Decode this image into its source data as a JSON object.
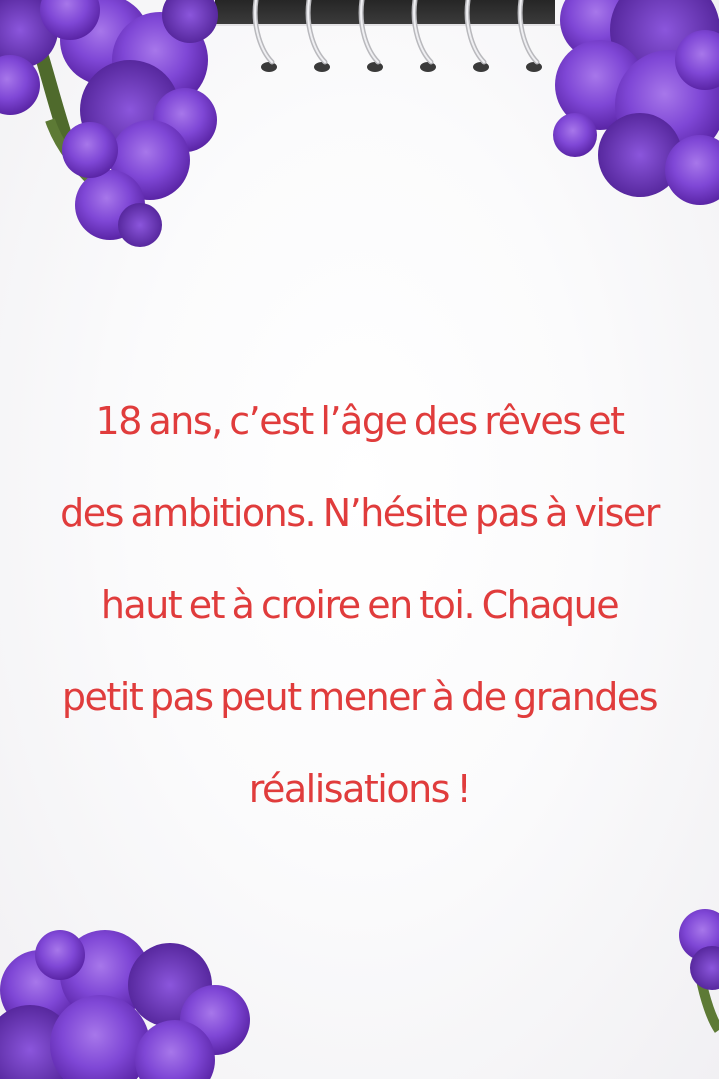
{
  "quote": {
    "lines": [
      "18 ans, c’est l’âge des rêves et",
      "des ambitions. N’hésite pas à viser",
      "haut et à croire en toi. Chaque",
      "petit pas peut mener à de grandes",
      "réalisations !"
    ]
  },
  "colors": {
    "text": "#e03c3c",
    "paper": "#ffffff",
    "flowers": "#7a3fd0",
    "binding": "#2b2b2b"
  },
  "icons": {
    "binding": "spiral-ring",
    "decoration": "purple-statice-flower"
  }
}
